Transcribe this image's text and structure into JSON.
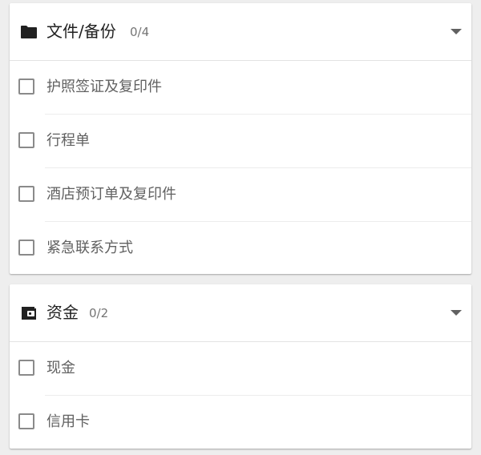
{
  "sections": [
    {
      "title": "文件/备份",
      "count": "0/4",
      "icon": "folder-icon",
      "items": [
        {
          "label": "护照签证及复印件",
          "checked": false
        },
        {
          "label": "行程单",
          "checked": false
        },
        {
          "label": "酒店预订单及复印件",
          "checked": false
        },
        {
          "label": "紧急联系方式",
          "checked": false
        }
      ]
    },
    {
      "title": "资金",
      "count": "0/2",
      "icon": "wallet-icon",
      "items": [
        {
          "label": "现金",
          "checked": false
        },
        {
          "label": "信用卡",
          "checked": false
        }
      ]
    }
  ],
  "colors": {
    "background": "#eeeeee",
    "card": "#ffffff",
    "title_text": "#212121",
    "item_text": "#616161",
    "count_text": "#757575",
    "checkbox_border": "#8a8a8a"
  }
}
